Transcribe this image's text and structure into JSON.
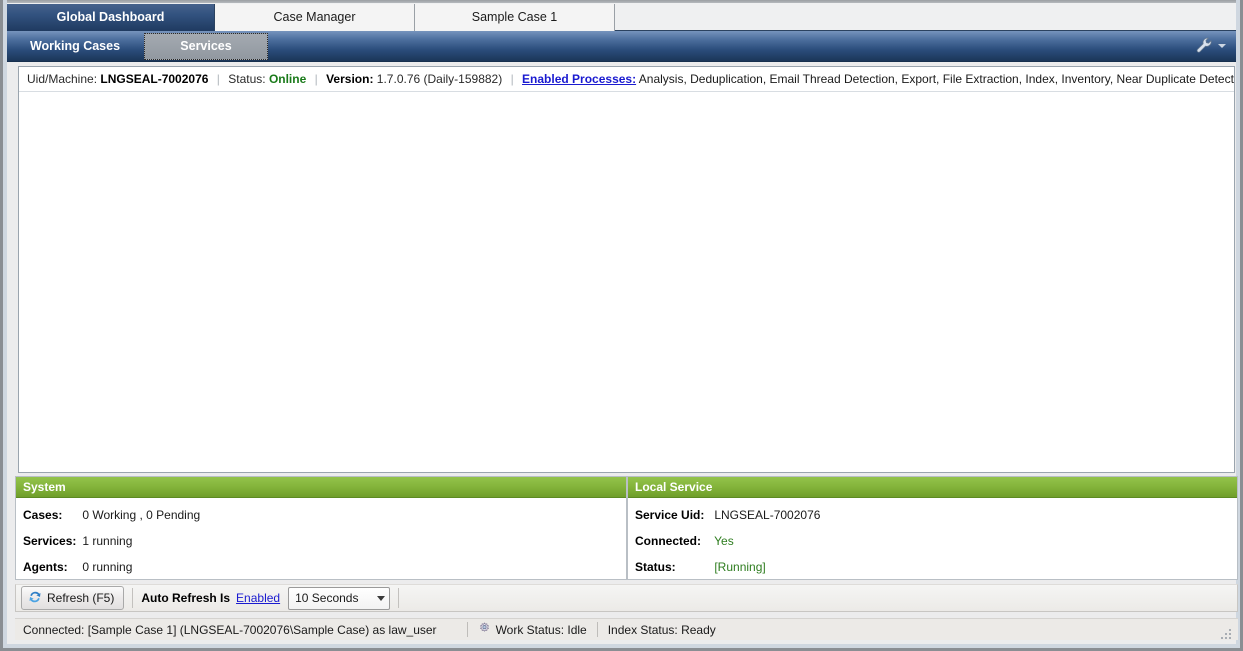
{
  "tabs": [
    {
      "label": "Global Dashboard",
      "active": true
    },
    {
      "label": "Case Manager",
      "active": false
    },
    {
      "label": "Sample Case 1",
      "active": false
    }
  ],
  "ribbon": {
    "subtabs": [
      {
        "label": "Working Cases",
        "selected": false
      },
      {
        "label": "Services",
        "selected": true
      }
    ],
    "tools_icon": "wrench-icon"
  },
  "info_bar": {
    "uid_label": "Uid/Machine:",
    "uid_value": "LNGSEAL-7002076",
    "status_label": "Status:",
    "status_value": "Online",
    "version_label": "Version:",
    "version_value": "1.7.0.76 (Daily-159882)",
    "processes_link": "Enabled Processes:",
    "processes_value": "Analysis, Deduplication, Email Thread Detection, Export, File Extraction, Index, Inventory, Near Duplicate Detection, NIST"
  },
  "panels": {
    "system": {
      "title": "System",
      "rows": [
        {
          "key": "Cases:",
          "value": "0 Working ,  0 Pending",
          "green": false
        },
        {
          "key": "Services:",
          "value": "1 running",
          "green": false
        },
        {
          "key": "Agents:",
          "value": "0 running",
          "green": false
        }
      ]
    },
    "local_service": {
      "title": "Local Service",
      "rows": [
        {
          "key": "Service Uid:",
          "value": "LNGSEAL-7002076",
          "green": false
        },
        {
          "key": "Connected:",
          "value": "Yes",
          "green": true
        },
        {
          "key": "Status:",
          "value": "[Running]",
          "green": true
        }
      ]
    }
  },
  "toolbar": {
    "refresh_label": "Refresh (F5)",
    "refresh_icon": "refresh-icon",
    "auto_refresh_label": "Auto Refresh Is",
    "auto_refresh_state": "Enabled",
    "interval_value": "10 Seconds"
  },
  "statusbar": {
    "connection_text": "Connected: [Sample Case 1] (LNGSEAL-7002076\\Sample Case) as law_user",
    "work_status": "Work Status: Idle",
    "work_status_icon": "gear-icon",
    "index_status": "Index Status: Ready"
  },
  "colors": {
    "ribbon_blue": "#2b4d7c",
    "tab_active_blue": "#32527f",
    "panel_green": "#85b53c",
    "link_blue": "#1a1ad0",
    "online_green": "#1a7a1a"
  }
}
